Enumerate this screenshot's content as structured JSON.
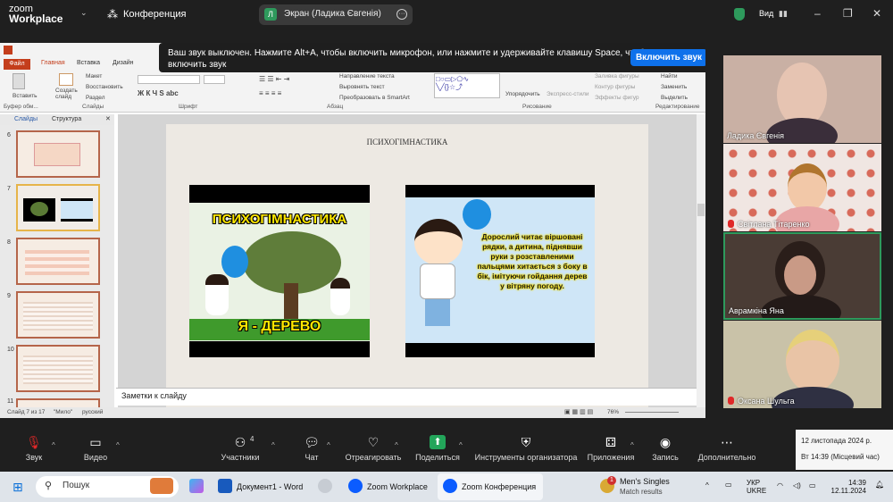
{
  "app": {
    "logo_line1": "zoom",
    "logo_line2": "Workplace",
    "meeting_label": "Конференция",
    "share_pill": "Экран (Ладика Євгенія)",
    "share_pill_icon_letter": "Л",
    "view_label": "Вид"
  },
  "notification": {
    "text": "Ваш звук выключен. Нажмите Alt+A, чтобы включить микрофон, или нажмите и удерживайте клавишу Space, чтобы временно включить звук",
    "button": "Включить звук"
  },
  "ppt": {
    "tabs": [
      "Файл",
      "Главная",
      "Вставка",
      "Дизайн"
    ],
    "groups": [
      "Буфер обм...",
      "Слайды",
      "Шрифт",
      "Абзац",
      "Рисование",
      "Редактирование"
    ],
    "ribbon_items": [
      "Макет",
      "Восстановить",
      "Раздел",
      "Создать слайд",
      "Вставить",
      "Направление текста",
      "Выровнять текст",
      "Преобразовать в SmartArt",
      "Упорядочить",
      "Экспресс-стили",
      "Заливка фигуры",
      "Контур фигуры",
      "Эффекты фигур",
      "Найти",
      "Заменить",
      "Выделить"
    ],
    "pane_tabs": [
      "Слайды",
      "Структура"
    ],
    "slide_numbers": [
      "6",
      "7",
      "8",
      "9",
      "10",
      "11"
    ],
    "slide_title": "ПСИХОГІМНАСТИКА",
    "image1_title": "ПСИХОГІМНАСТИКА",
    "image1_caption": "Я - ДЕРЕВО",
    "image2_text": "Дорослий читає віршовані рядки, а дитина, піднявши руки з розставленими пальцями хитається з боку в бік, імітуючи гойдання дерев у вітряну погоду.",
    "notes_placeholder": "Заметки к слайду",
    "status_slide": "Слайд 7 из 17",
    "status_theme": "\"Мило\"",
    "status_lang": "русский",
    "zoom_level": "76%"
  },
  "participants": [
    {
      "name": "Ладика Євгенія",
      "muted": false,
      "bg": "#c9b0a4"
    },
    {
      "name": "Світлана Тітаренко",
      "muted": true,
      "bg": "#f0e6e2"
    },
    {
      "name": "Аврамкіна Яна",
      "muted": false,
      "bg": "#4a3c35"
    },
    {
      "name": "Оксана Шульга",
      "muted": true,
      "bg": "#c9c2a8"
    }
  ],
  "toolbar": {
    "audio": "Звук",
    "video": "Видео",
    "participants": "Участники",
    "participants_count": "4",
    "chat": "Чат",
    "react": "Отреагировать",
    "share": "Поделиться",
    "host_tools": "Инструменты организатора",
    "apps": "Приложения",
    "record": "Запись",
    "more": "Дополнительно"
  },
  "date_tooltip": {
    "date": "12 листопада 2024 р.",
    "time": "Вт 14:39 (Місцевий час)"
  },
  "taskbar": {
    "search": "Пошук",
    "word": "Документ1 - Word",
    "zoom_workplace": "Zoom Workplace",
    "zoom_conf": "Zoom Конференция",
    "notif_title": "Men's Singles",
    "notif_sub": "Match results",
    "notif_badge": "1",
    "lang1": "УКР",
    "lang2": "UKRE",
    "clock_time": "14:39",
    "clock_date": "12.11.2024"
  },
  "colors": {
    "accent": "#0e71eb",
    "ppt_red": "#c43e1c",
    "active_tile_border": "#2e9a5c",
    "mute_red": "#e02828"
  }
}
